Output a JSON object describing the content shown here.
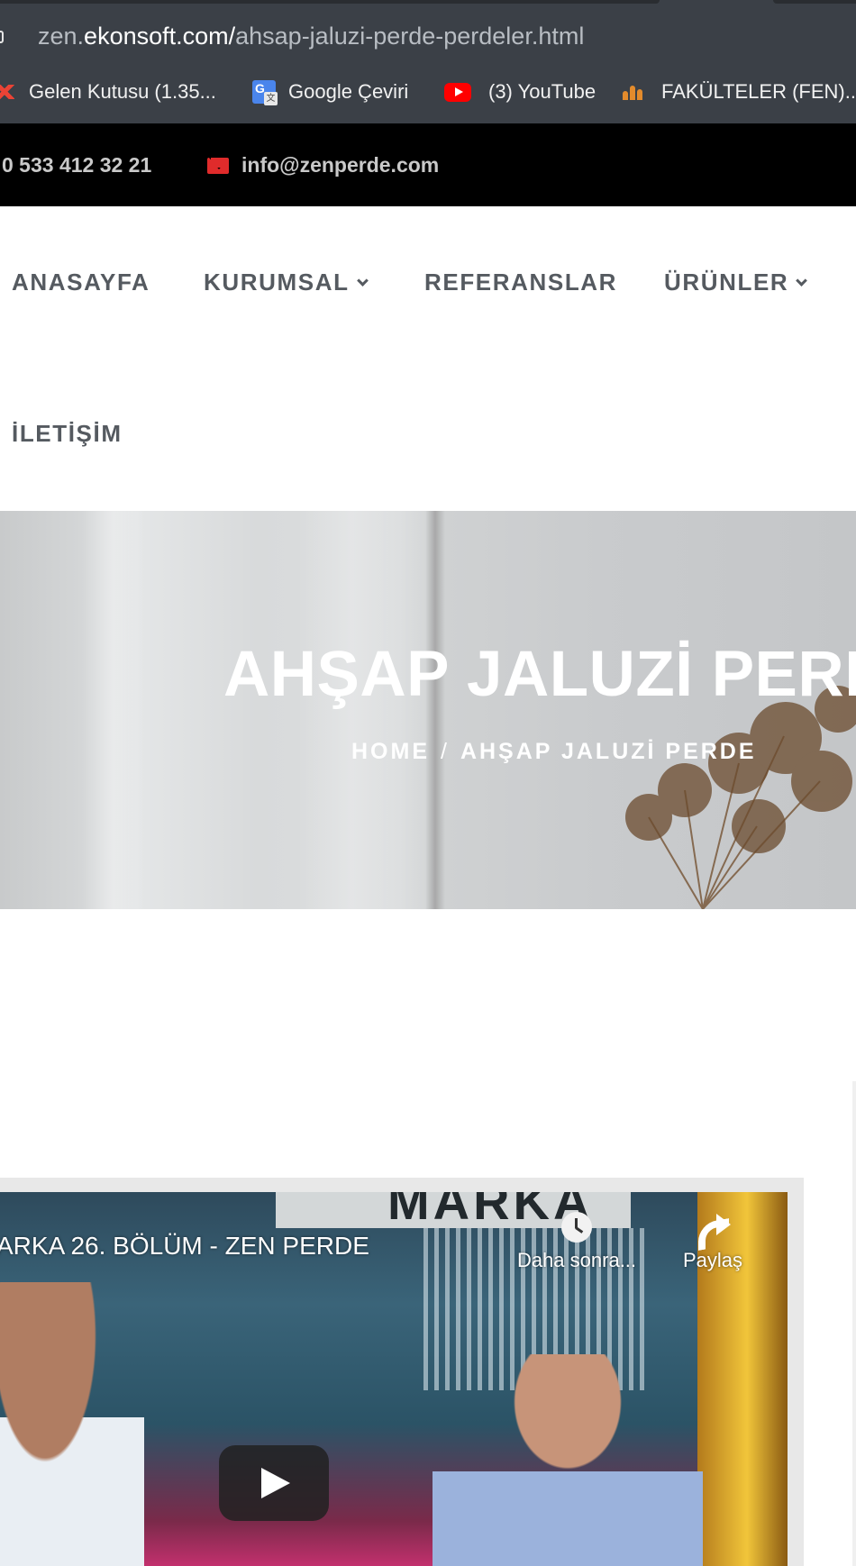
{
  "browser": {
    "url_prefix": "zen.",
    "url_domain": "ekonsoft.com/",
    "url_path": "ahsap-jaluzi-perde-perdeler.html",
    "bookmarks": [
      {
        "label": "Gelen Kutusu (1.35...",
        "icon": "gmail-icon"
      },
      {
        "label": "Google Çeviri",
        "icon": "google-translate-icon"
      },
      {
        "label": "(3) YouTube",
        "icon": "youtube-icon"
      },
      {
        "label": "FAKÜLTELER (FEN)...",
        "icon": "faculty-icon"
      }
    ]
  },
  "topbar": {
    "phone": "0 533 412 32 21",
    "email": "info@zenperde.com",
    "accent_color": "#e02b2b"
  },
  "nav": {
    "items": [
      {
        "label": "ANASAYFA"
      },
      {
        "label": "KURUMSAL"
      },
      {
        "label": "REFERANSLAR"
      },
      {
        "label": "ÜRÜNLER"
      },
      {
        "label": "İLETİŞİM"
      }
    ]
  },
  "hero": {
    "title": "AHŞAP JALUZİ PERDE",
    "breadcrumb_home": "HOME",
    "breadcrumb_sep": "/",
    "breadcrumb_current": "AHŞAP JALUZİ PERDE"
  },
  "video": {
    "title": "ARKA 26. BÖLÜM - ZEN PERDE",
    "sign_text": "MARKA",
    "watch_later": "Daha sonra...",
    "share": "Paylaş"
  }
}
